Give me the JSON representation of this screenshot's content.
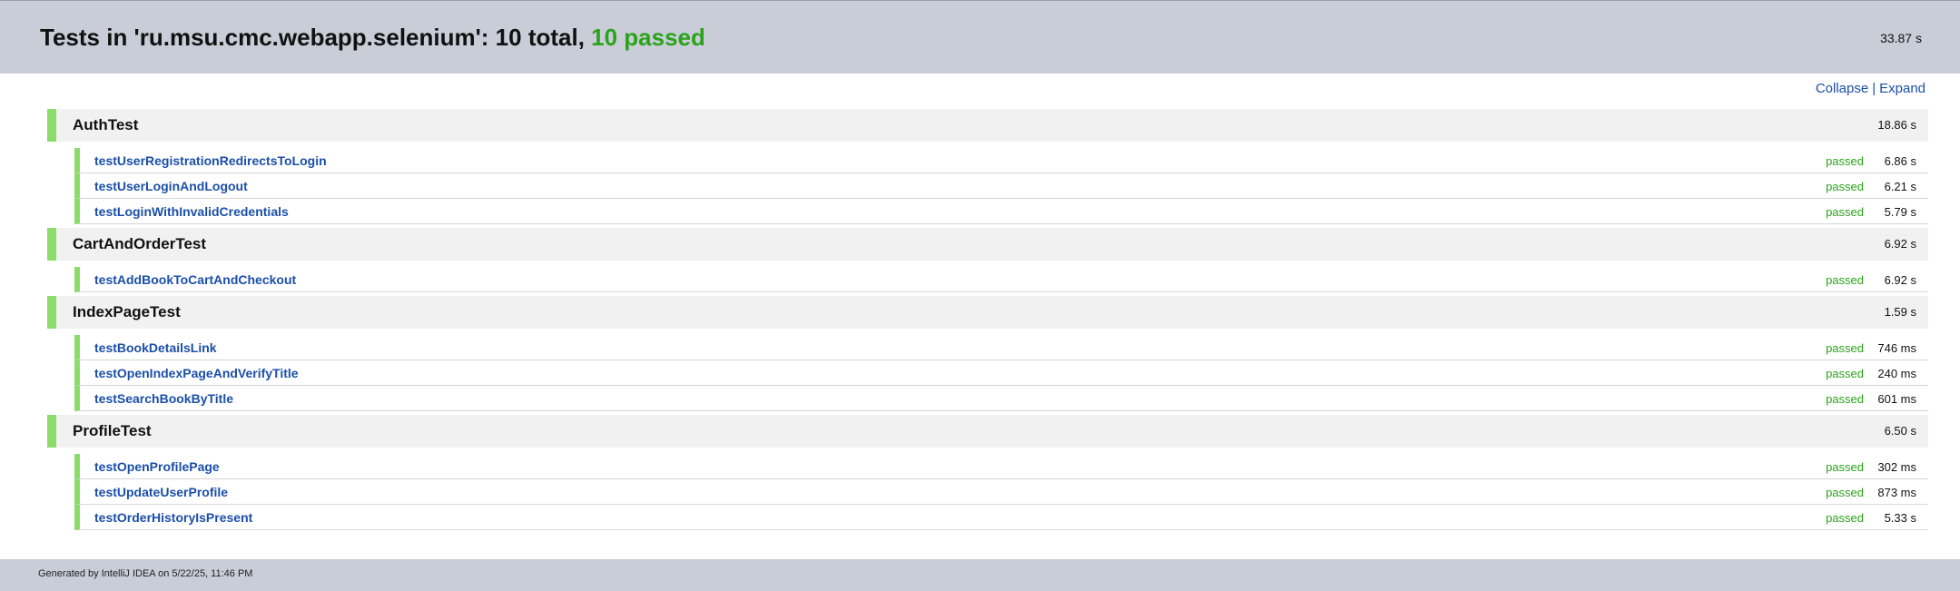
{
  "header": {
    "title_prefix": "Tests in 'ru.msu.cmc.webapp.selenium': 10 total, ",
    "title_passed": "10 passed",
    "total_time": "33.87 s"
  },
  "controls": {
    "collapse": "Collapse",
    "separator": "|",
    "expand": "Expand"
  },
  "suites": [
    {
      "name": "AuthTest",
      "time": "18.86 s",
      "tests": [
        {
          "name": "testUserRegistrationRedirectsToLogin",
          "status": "passed",
          "time": "6.86 s"
        },
        {
          "name": "testUserLoginAndLogout",
          "status": "passed",
          "time": "6.21 s"
        },
        {
          "name": "testLoginWithInvalidCredentials",
          "status": "passed",
          "time": "5.79 s"
        }
      ]
    },
    {
      "name": "CartAndOrderTest",
      "time": "6.92 s",
      "tests": [
        {
          "name": "testAddBookToCartAndCheckout",
          "status": "passed",
          "time": "6.92 s"
        }
      ]
    },
    {
      "name": "IndexPageTest",
      "time": "1.59 s",
      "tests": [
        {
          "name": "testBookDetailsLink",
          "status": "passed",
          "time": "746 ms"
        },
        {
          "name": "testOpenIndexPageAndVerifyTitle",
          "status": "passed",
          "time": "240 ms"
        },
        {
          "name": "testSearchBookByTitle",
          "status": "passed",
          "time": "601 ms"
        }
      ]
    },
    {
      "name": "ProfileTest",
      "time": "6.50 s",
      "tests": [
        {
          "name": "testOpenProfilePage",
          "status": "passed",
          "time": "302 ms"
        },
        {
          "name": "testUpdateUserProfile",
          "status": "passed",
          "time": "873 ms"
        },
        {
          "name": "testOrderHistoryIsPresent",
          "status": "passed",
          "time": "5.33 s"
        }
      ]
    }
  ],
  "footer": {
    "generated": "Generated by IntelliJ IDEA on 5/22/25, 11:46 PM"
  },
  "colors": {
    "header_bg": "#c8cdd8",
    "passed_green": "#2aa319",
    "status_bar_green": "#8cdc6a",
    "link_blue": "#1b4fa8"
  }
}
